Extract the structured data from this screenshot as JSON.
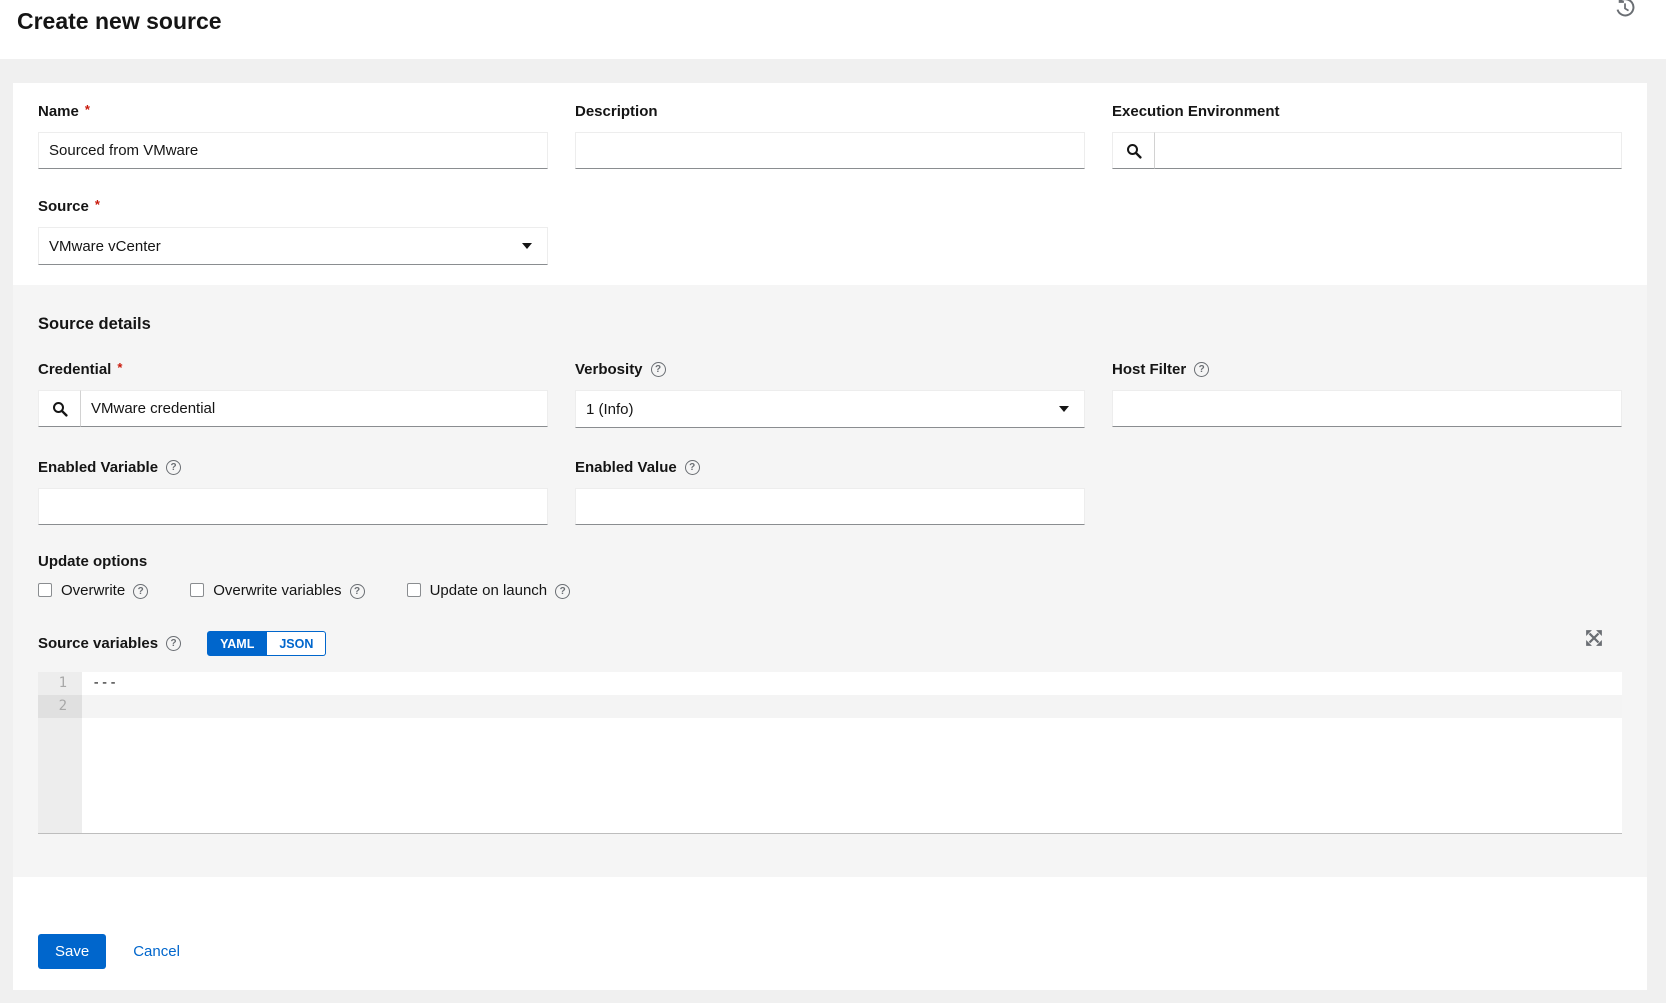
{
  "title": "Create new source",
  "fields": {
    "name": {
      "label": "Name",
      "required": "*",
      "value": "Sourced from VMware"
    },
    "description": {
      "label": "Description",
      "value": ""
    },
    "execution_environment": {
      "label": "Execution Environment",
      "value": ""
    },
    "source": {
      "label": "Source",
      "required": "*",
      "value": "VMware vCenter"
    }
  },
  "details": {
    "heading": "Source details",
    "credential": {
      "label": "Credential",
      "required": "*",
      "value": "VMware credential"
    },
    "verbosity": {
      "label": "Verbosity",
      "value": "1 (Info)"
    },
    "host_filter": {
      "label": "Host Filter",
      "value": ""
    },
    "enabled_variable": {
      "label": "Enabled Variable",
      "value": ""
    },
    "enabled_value": {
      "label": "Enabled Value",
      "value": ""
    },
    "update_options": {
      "heading": "Update options",
      "items": [
        {
          "label": "Overwrite",
          "checked": false
        },
        {
          "label": "Overwrite variables",
          "checked": false
        },
        {
          "label": "Update on launch",
          "checked": false
        }
      ]
    },
    "source_variables": {
      "label": "Source variables",
      "mode_yaml": "YAML",
      "mode_json": "JSON",
      "selected_mode": "YAML",
      "editor": {
        "lines": [
          {
            "number": "1",
            "content": "---"
          },
          {
            "number": "2",
            "content": ""
          }
        ]
      }
    }
  },
  "footer": {
    "save": "Save",
    "cancel": "Cancel"
  },
  "glyphs": {
    "help": "?"
  },
  "icons": [
    "history-icon",
    "search-icon",
    "question-circle-icon",
    "caret-down-icon",
    "expand-arrows-icon"
  ],
  "colors": {
    "accent": "#0066cc",
    "required_red": "#c9190b",
    "page_bg": "#f0f0f0",
    "section_bg": "#f5f5f5"
  }
}
